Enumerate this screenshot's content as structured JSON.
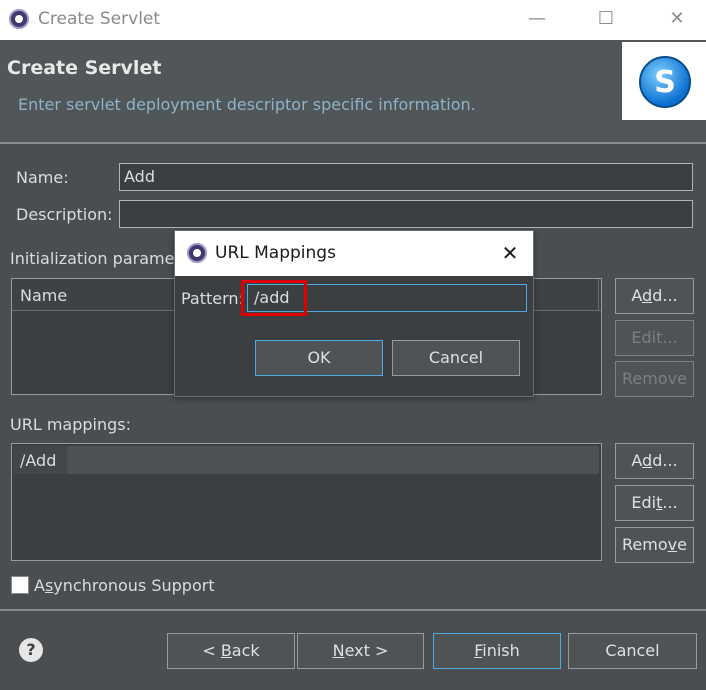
{
  "window": {
    "title": "Create Servlet",
    "minimize": "—",
    "maximize": "☐",
    "close": "✕"
  },
  "header": {
    "title": "Create Servlet",
    "subtitle": "Enter servlet deployment descriptor specific information."
  },
  "form": {
    "name_label": "Name:",
    "name_value": "Add",
    "description_label": "Description:",
    "description_value": "",
    "init_params_label": "Initialization parame",
    "init_table_col": "Name",
    "init_buttons": {
      "add_pre": "A",
      "add_u": "d",
      "add_post": "d...",
      "edit": "Edit...",
      "remove": "Remove"
    },
    "url_mappings_label": "URL mappings:",
    "url_mappings": [
      "/Add"
    ],
    "url_buttons": {
      "add_pre": "A",
      "add_u": "d",
      "add_post": "d...",
      "edit_pre": "Edi",
      "edit_u": "t",
      "edit_post": "...",
      "remove_pre": "Remo",
      "remove_u": "v",
      "remove_post": "e"
    },
    "async_pre": "A",
    "async_u": "s",
    "async_post": "ynchronous Support",
    "async_checked": false
  },
  "footer": {
    "help": "?",
    "back_pre": "< ",
    "back_u": "B",
    "back_post": "ack",
    "next_u": "N",
    "next_post": "ext >",
    "finish_u": "F",
    "finish_post": "inish",
    "cancel": "Cancel"
  },
  "dialog": {
    "title": "URL Mappings",
    "close": "✕",
    "pattern_label": "Pattern:",
    "pattern_value": "/add",
    "ok": "OK",
    "cancel": "Cancel",
    "highlight_color": "#e00000"
  },
  "colors": {
    "accent": "#4fa8e0",
    "subtitle": "#8fb3c8"
  }
}
